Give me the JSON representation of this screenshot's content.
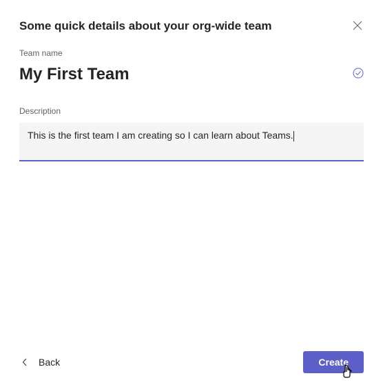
{
  "header": {
    "title": "Some quick details about your org-wide team"
  },
  "fields": {
    "team_name_label": "Team name",
    "team_name_value": "My First Team",
    "description_label": "Description",
    "description_value": "This is the first team I am creating so I can learn about Teams."
  },
  "footer": {
    "back_label": "Back",
    "create_label": "Create"
  },
  "colors": {
    "accent": "#5b5fc7"
  }
}
